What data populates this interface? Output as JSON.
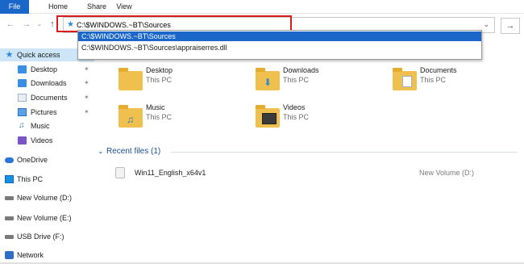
{
  "ribbon": {
    "tabs": [
      {
        "label": "File"
      },
      {
        "label": "Home"
      },
      {
        "label": "Share"
      },
      {
        "label": "View"
      }
    ]
  },
  "nav": {
    "back_icon": "arrow-left-icon",
    "forward_icon": "arrow-right-icon",
    "recent_icon": "chevron-down-icon",
    "up_icon": "arrow-up-icon",
    "address_value": "C:\\$WINDOWS.~BT\\Sources",
    "go_icon": "arrow-right-icon"
  },
  "autocomplete": {
    "items": [
      "C:\\$WINDOWS.~BT\\Sources",
      "C:\\$WINDOWS.~BT\\Sources\\appraiserres.dll"
    ]
  },
  "sidebar": {
    "items": [
      {
        "label": "Quick access",
        "icon": "star-icon"
      },
      {
        "label": "Desktop",
        "icon": "desktop-folder-icon"
      },
      {
        "label": "Downloads",
        "icon": "downloads-folder-icon"
      },
      {
        "label": "Documents",
        "icon": "documents-folder-icon"
      },
      {
        "label": "Pictures",
        "icon": "pictures-folder-icon"
      },
      {
        "label": "Music",
        "icon": "music-icon"
      },
      {
        "label": "Videos",
        "icon": "videos-folder-icon"
      },
      {
        "label": "OneDrive",
        "icon": "cloud-icon"
      },
      {
        "label": "This PC",
        "icon": "computer-icon"
      },
      {
        "label": "New Volume (D:)",
        "icon": "drive-icon"
      },
      {
        "label": "New Volume (E:)",
        "icon": "drive-icon"
      },
      {
        "label": "USB Drive (F:)",
        "icon": "usb-drive-icon"
      },
      {
        "label": "Network",
        "icon": "network-icon"
      }
    ]
  },
  "main": {
    "folders": [
      {
        "name": "Desktop",
        "location": "This PC"
      },
      {
        "name": "Downloads",
        "location": "This PC"
      },
      {
        "name": "Documents",
        "location": "This PC"
      },
      {
        "name": "Music",
        "location": "This PC"
      },
      {
        "name": "Videos",
        "location": "This PC"
      }
    ],
    "recent_header": "Recent files (1)",
    "recent_files": [
      {
        "name": "Win11_English_x64v1",
        "location": "New Volume (D:)"
      }
    ]
  },
  "colors": {
    "accent": "#1a66c9",
    "highlight_box": "#d81c1c",
    "folder": "#f0c04f"
  }
}
